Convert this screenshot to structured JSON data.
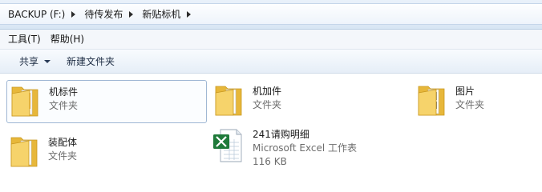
{
  "address_bar": {
    "crumbs": [
      "BACKUP (F:)",
      "待传发布",
      "新贴标机"
    ]
  },
  "menu": {
    "items": [
      "工具(T)",
      "帮助(H)"
    ]
  },
  "toolbar": {
    "share_label": "共享",
    "new_folder_label": "新建文件夹"
  },
  "files": [
    {
      "name": "机标件",
      "type": "文件夹",
      "size": "",
      "icon": "folder-icon",
      "selected": true
    },
    {
      "name": "机加件",
      "type": "文件夹",
      "size": "",
      "icon": "folder-icon",
      "selected": false
    },
    {
      "name": "图片",
      "type": "文件夹",
      "size": "",
      "icon": "folder-icon",
      "selected": false
    },
    {
      "name": "装配体",
      "type": "文件夹",
      "size": "",
      "icon": "folder-icon",
      "selected": false
    },
    {
      "name": "241请购明细",
      "type": "Microsoft Excel 工作表",
      "size": "116 KB",
      "icon": "excel-file-icon",
      "selected": false
    }
  ],
  "colors": {
    "folder_yellow": "#f2c94c",
    "excel_green": "#1f7a3a",
    "selection_border": "#9fb7d4"
  }
}
